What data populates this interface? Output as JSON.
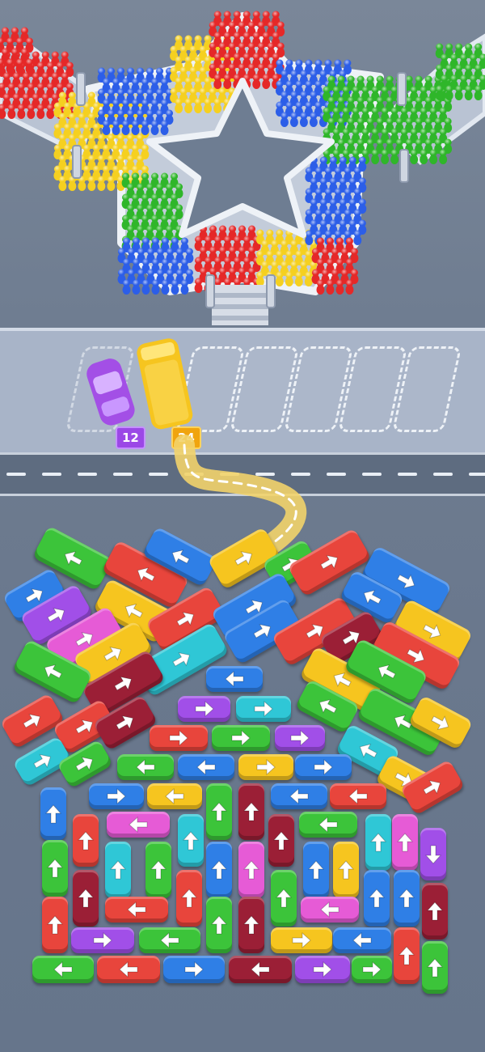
{
  "game": {
    "parking_badges": [
      {
        "value": "12",
        "color": "#9b48e6"
      },
      {
        "value": "24",
        "color": "#f0a40e"
      }
    ],
    "empty_slots": 6,
    "crowd_colors": [
      "#e52828",
      "#f5d020",
      "#2c5ee8",
      "#2fb62a"
    ],
    "bus_colors": {
      "red": "#e8453c",
      "yellow": "#f6c51f",
      "blue": "#2f7fe6",
      "green": "#3cc43a",
      "cyan": "#2fc7d6",
      "pink": "#e65bd6",
      "purple": "#a14fe8",
      "maroon": "#9b1f36",
      "lime": "#43d05a"
    }
  }
}
